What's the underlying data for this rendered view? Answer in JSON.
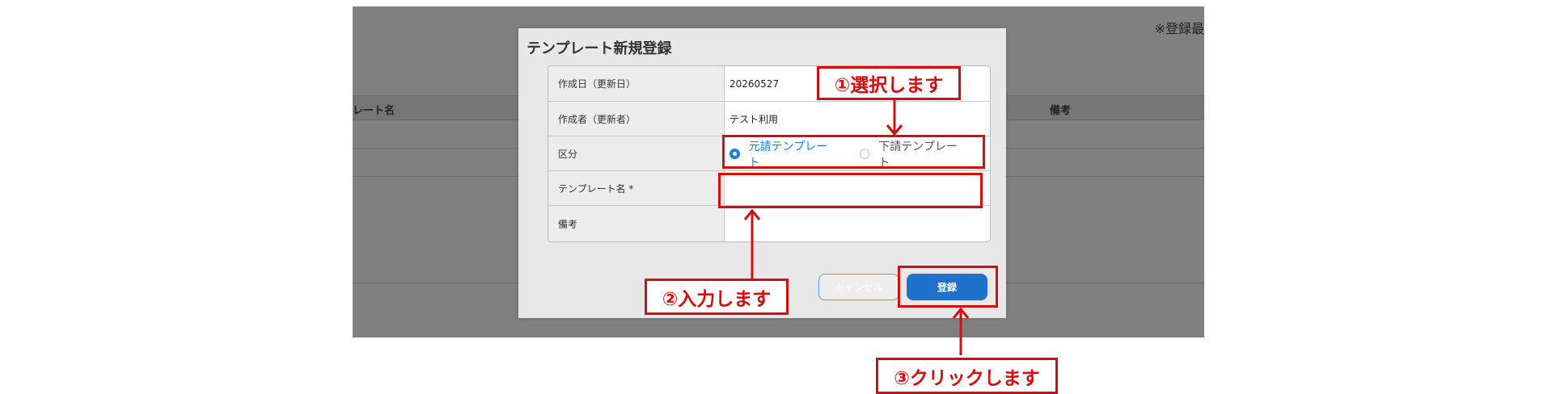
{
  "background": {
    "note": "※登録最",
    "columns": {
      "name": "レート名",
      "remarks": "備考"
    }
  },
  "modal": {
    "title": "テンプレート新規登録",
    "rows": {
      "created_date": {
        "label": "作成日（更新日）",
        "value": "20260527"
      },
      "creator": {
        "label": "作成者（更新者）",
        "value": "テスト利用"
      },
      "category": {
        "label": "区分",
        "options": [
          {
            "label": "元請テンプレート",
            "selected": true
          },
          {
            "label": "下請テンプレート",
            "selected": false
          }
        ]
      },
      "template_name": {
        "label": "テンプレート名 *",
        "value": ""
      },
      "remarks": {
        "label": "備考",
        "value": ""
      }
    },
    "buttons": {
      "cancel": "キャンセル",
      "register": "登録"
    }
  },
  "annotations": {
    "step1": "①選択します",
    "step2": "②入力します",
    "step3": "③クリックします",
    "color": "#d40d0d"
  },
  "colors": {
    "accent": "#1e72cc",
    "overlay": "#808080",
    "annotation": "#d40d0d"
  }
}
